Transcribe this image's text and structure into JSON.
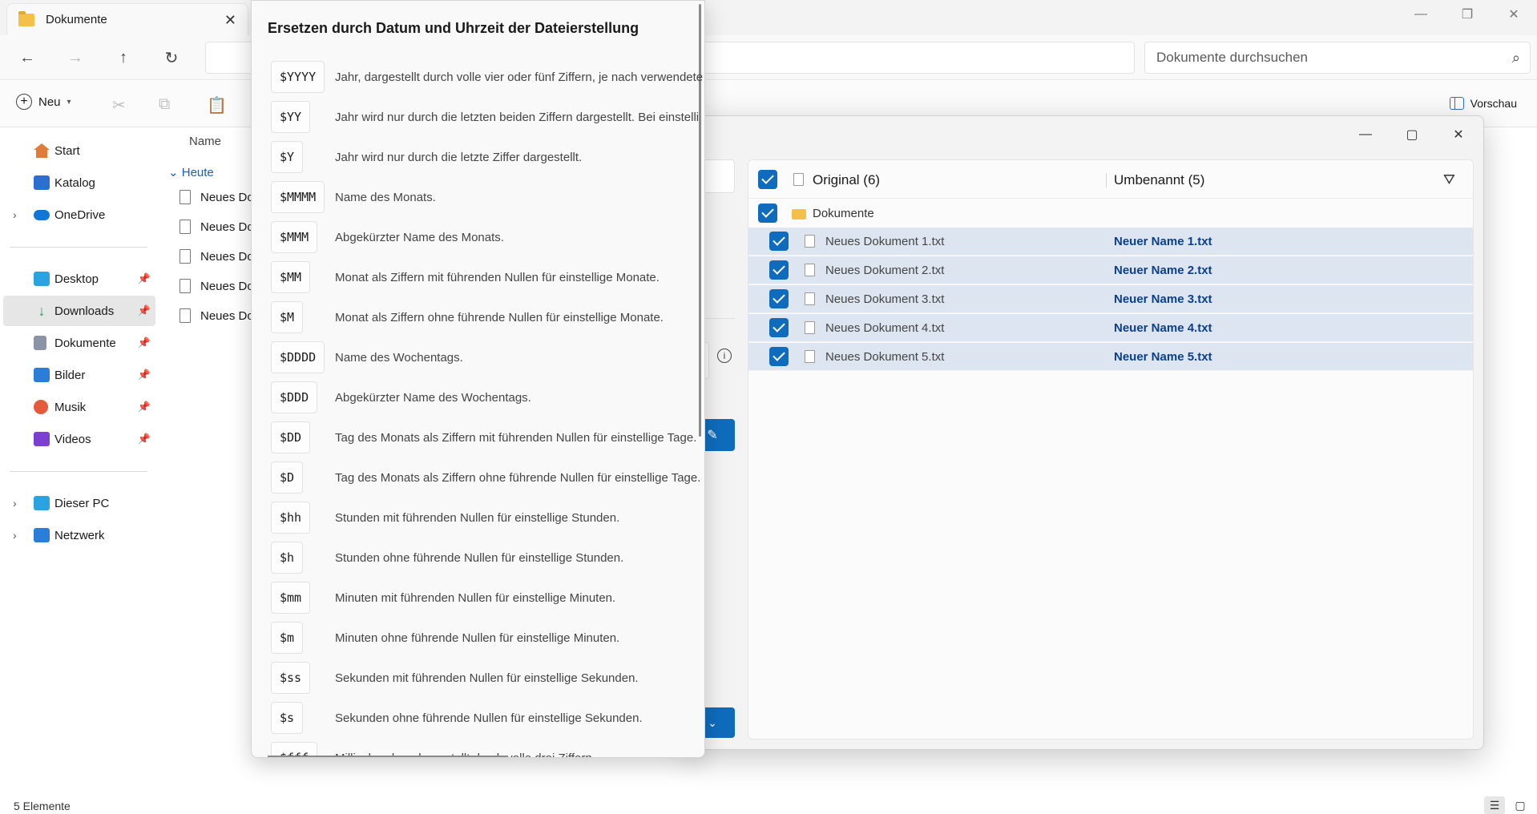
{
  "explorer": {
    "tab_title": "Dokumente",
    "search_placeholder": "Dokumente durchsuchen",
    "cmd_new": "Neu",
    "cmd_preview": "Vorschau",
    "sidebar": {
      "top": [
        {
          "label": "Start",
          "color": "#e07b39"
        },
        {
          "label": "Katalog",
          "color": "#2b6fd1"
        },
        {
          "label": "OneDrive",
          "color": "#0f78d4"
        }
      ],
      "pinned": [
        {
          "label": "Desktop",
          "color": "#2aa3e0"
        },
        {
          "label": "Downloads",
          "color": "#1e9e58"
        },
        {
          "label": "Dokumente",
          "color": "#8a94a6"
        },
        {
          "label": "Bilder",
          "color": "#2b7ed8"
        },
        {
          "label": "Musik",
          "color": "#e45a3a"
        },
        {
          "label": "Videos",
          "color": "#7b3fd1"
        }
      ],
      "bottom": [
        {
          "label": "Dieser PC",
          "color": "#2aa3e0"
        },
        {
          "label": "Netzwerk",
          "color": "#2b7ed8"
        }
      ]
    },
    "column_name": "Name",
    "group_today": "Heute",
    "files": [
      "Neues Do",
      "Neues Do",
      "Neues Do",
      "Neues Do",
      "Neues Do"
    ],
    "status_count": "5 Elemente"
  },
  "renamer": {
    "header_original": "Original (6)",
    "header_renamed": "Umbenannt (5)",
    "folder_label": "Dokumente",
    "items": [
      {
        "original": "Neues Dokument 1.txt",
        "renamed": "Neuer Name 1.txt"
      },
      {
        "original": "Neues Dokument 2.txt",
        "renamed": "Neuer Name 2.txt"
      },
      {
        "original": "Neues Dokument 3.txt",
        "renamed": "Neuer Name 3.txt"
      },
      {
        "original": "Neues Dokument 4.txt",
        "renamed": "Neuer Name 4.txt"
      },
      {
        "original": "Neues Dokument 5.txt",
        "renamed": "Neuer Name 5.txt"
      }
    ],
    "accent": "#0f6cbd"
  },
  "flyout": {
    "title": "Ersetzen durch Datum und Uhrzeit der Dateierstellung",
    "rows": [
      {
        "token": "$YYYY",
        "desc": "Jahr, dargestellt durch volle vier oder fünf Ziffern, je nach verwendete"
      },
      {
        "token": "$YY",
        "desc": "Jahr wird nur durch die letzten beiden Ziffern dargestellt. Bei einstelli"
      },
      {
        "token": "$Y",
        "desc": "Jahr wird nur durch die letzte Ziffer dargestellt."
      },
      {
        "token": "$MMMM",
        "desc": "Name des Monats."
      },
      {
        "token": "$MMM",
        "desc": "Abgekürzter Name des Monats."
      },
      {
        "token": "$MM",
        "desc": "Monat als Ziffern mit führenden Nullen für einstellige Monate."
      },
      {
        "token": "$M",
        "desc": "Monat als Ziffern ohne führende Nullen für einstellige Monate."
      },
      {
        "token": "$DDDD",
        "desc": "Name des Wochentags."
      },
      {
        "token": "$DDD",
        "desc": "Abgekürzter Name des Wochentags."
      },
      {
        "token": "$DD",
        "desc": "Tag des Monats als Ziffern mit führenden Nullen für einstellige Tage."
      },
      {
        "token": "$D",
        "desc": "Tag des Monats als Ziffern ohne führende Nullen für einstellige Tage."
      },
      {
        "token": "$hh",
        "desc": "Stunden mit führenden Nullen für einstellige Stunden."
      },
      {
        "token": "$h",
        "desc": "Stunden ohne führende Nullen für einstellige Stunden."
      },
      {
        "token": "$mm",
        "desc": "Minuten mit führenden Nullen für einstellige Minuten."
      },
      {
        "token": "$m",
        "desc": "Minuten ohne führende Nullen für einstellige Minuten."
      },
      {
        "token": "$ss",
        "desc": "Sekunden mit führenden Nullen für einstellige Sekunden."
      },
      {
        "token": "$s",
        "desc": "Sekunden ohne führende Nullen für einstellige Sekunden."
      },
      {
        "token": "$fff",
        "desc": "Millisekunden, dargestellt durch volle drei Ziffern."
      }
    ]
  },
  "icons": {
    "close": "close-icon",
    "back": "back-arrow-icon",
    "forward": "forward-arrow-icon",
    "up": "up-arrow-icon",
    "refresh": "refresh-icon",
    "search": "search-icon",
    "filter": "filter-icon",
    "info": "info-icon"
  }
}
